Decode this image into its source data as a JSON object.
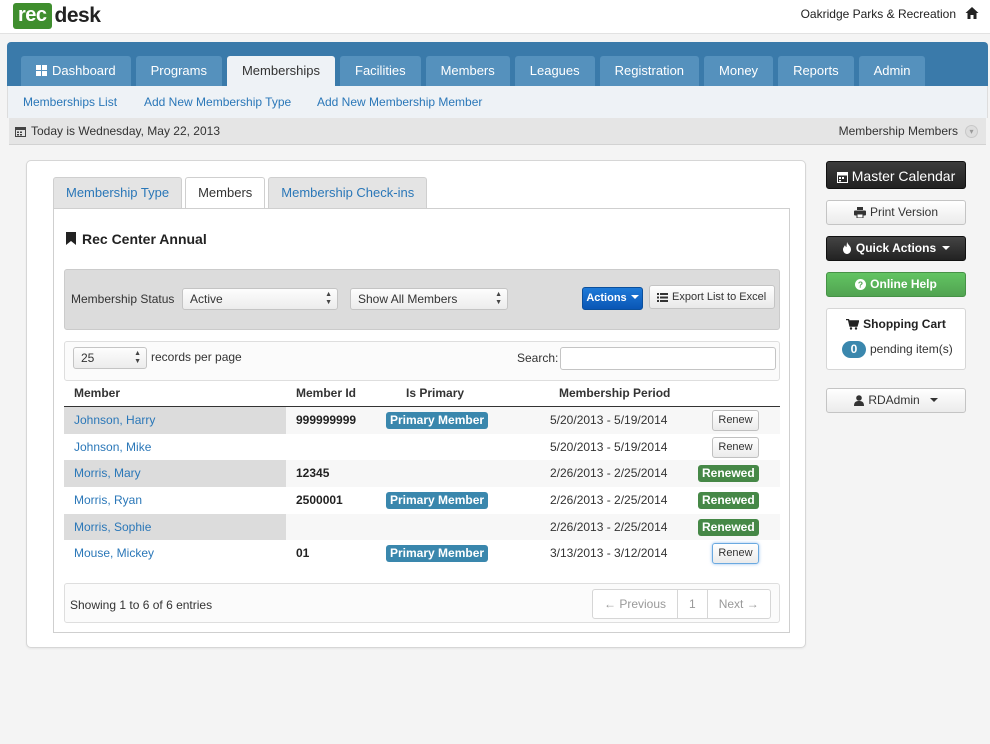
{
  "brand": {
    "logo_left": "rec",
    "logo_right": "desk",
    "org_name": "Oakridge Parks & Recreation"
  },
  "nav": {
    "tabs": [
      "Dashboard",
      "Programs",
      "Memberships",
      "Facilities",
      "Members",
      "Leagues",
      "Registration",
      "Money",
      "Reports",
      "Admin"
    ],
    "active_tab": "Memberships",
    "subnav": [
      "Memberships List",
      "Add New Membership Type",
      "Add New Membership Member"
    ]
  },
  "datebar": {
    "today": "Today is Wednesday, May 22, 2013",
    "crumb": "Membership Members"
  },
  "inner_tabs": [
    "Membership Type",
    "Members",
    "Membership Check-ins"
  ],
  "section_title": "Rec Center Annual",
  "filters": {
    "status_label": "Membership Status",
    "status_value": "Active",
    "members_value": "Show All Members",
    "actions_label": "Actions",
    "export_label": "Export List to Excel"
  },
  "table_controls": {
    "rpp_value": "25",
    "rpp_label": "records per page",
    "search_label": "Search:",
    "search_value": ""
  },
  "columns": [
    "Member",
    "Member Id",
    "Is Primary",
    "Membership Period"
  ],
  "rows": [
    {
      "member": "Johnson, Harry",
      "member_id": "999999999",
      "primary": "Primary Member",
      "period": "5/20/2013 -  5/19/2014",
      "action": "Renew"
    },
    {
      "member": "Johnson, Mike",
      "member_id": "",
      "primary": "",
      "period": "5/20/2013 -  5/19/2014",
      "action": "Renew"
    },
    {
      "member": "Morris, Mary",
      "member_id": "12345",
      "primary": "",
      "period": "2/26/2013 -  2/25/2014",
      "action": "Renewed"
    },
    {
      "member": "Morris, Ryan",
      "member_id": "2500001",
      "primary": "Primary Member",
      "period": "2/26/2013 -  2/25/2014",
      "action": "Renewed"
    },
    {
      "member": "Morris, Sophie",
      "member_id": "",
      "primary": "",
      "period": "2/26/2013 -  2/25/2014",
      "action": "Renewed"
    },
    {
      "member": "Mouse, Mickey",
      "member_id": "01",
      "primary": "Primary Member",
      "period": "3/13/2013 -  3/12/2014",
      "action": "Renew"
    }
  ],
  "footer": {
    "showing": "Showing 1 to 6 of 6 entries",
    "prev": "← Previous",
    "page": "1",
    "next": "Next →"
  },
  "sidebar": {
    "master_calendar": "Master Calendar",
    "print_version": "Print Version",
    "quick_actions": "Quick Actions",
    "online_help": "Online Help",
    "cart_title": "Shopping Cart",
    "cart_count": "0",
    "cart_pending": "pending item(s)",
    "user": "RDAdmin"
  },
  "colors": {
    "nav_blue": "#3a7aaa",
    "link_blue": "#2a77b8",
    "brand_green": "#3f8e2e",
    "badge_blue": "#3a87ad",
    "badge_green": "#468847"
  }
}
